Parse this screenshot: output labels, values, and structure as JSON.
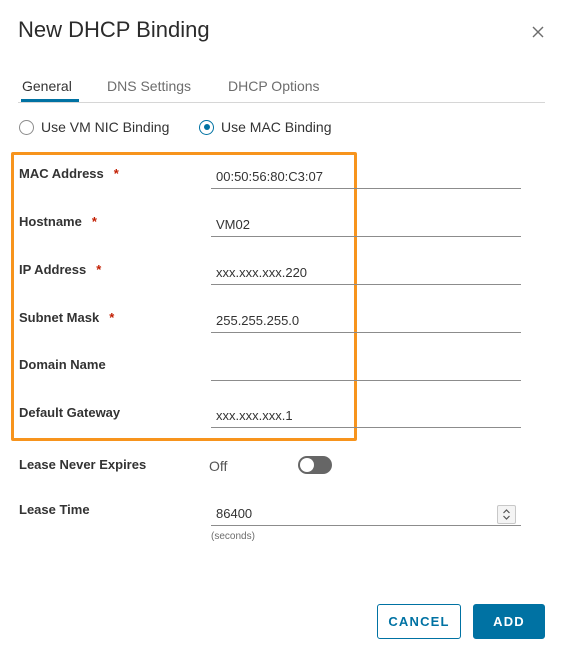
{
  "dialog": {
    "title": "New DHCP Binding"
  },
  "tabs": [
    {
      "label": "General",
      "active": true
    },
    {
      "label": "DNS Settings",
      "active": false
    },
    {
      "label": "DHCP Options",
      "active": false
    }
  ],
  "binding_type": {
    "options": [
      "Use VM NIC Binding",
      "Use MAC Binding"
    ],
    "selected": "Use MAC Binding"
  },
  "fields": {
    "mac_address": {
      "label": "MAC Address",
      "required": "*",
      "value": "00:50:56:80:C3:07"
    },
    "hostname": {
      "label": "Hostname",
      "required": "*",
      "value": "VM02"
    },
    "ip_address": {
      "label": "IP Address",
      "required": "*",
      "value": "xxx.xxx.xxx.220"
    },
    "subnet_mask": {
      "label": "Subnet Mask",
      "required": "*",
      "value": "255.255.255.0"
    },
    "domain_name": {
      "label": "Domain Name",
      "value": ""
    },
    "default_gateway": {
      "label": "Default Gateway",
      "value": "xxx.xxx.xxx.1"
    }
  },
  "lease_never_expires": {
    "label": "Lease Never Expires",
    "state_text": "Off",
    "enabled": false
  },
  "lease_time": {
    "label": "Lease Time",
    "value": "86400",
    "hint": "(seconds)"
  },
  "buttons": {
    "cancel": "CANCEL",
    "add": "ADD"
  },
  "colors": {
    "accent": "#0072a3",
    "highlight": "#f7941d",
    "required": "#c21d00"
  },
  "icons": {
    "close": "close-icon",
    "stepper": "chevron-up-down-icon"
  }
}
